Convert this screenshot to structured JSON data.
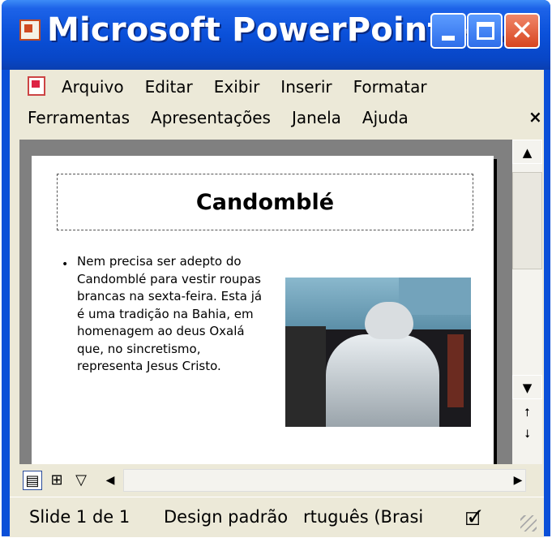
{
  "window": {
    "title": "Microsoft PowerPoint -..."
  },
  "titlebar_buttons": {
    "minimize": "_",
    "maximize": "□",
    "close": "✕"
  },
  "menu": {
    "row1": [
      "Arquivo",
      "Editar",
      "Exibir",
      "Inserir",
      "Formatar"
    ],
    "row2": [
      "Ferramentas",
      "Apresentações",
      "Janela",
      "Ajuda"
    ],
    "close_glyph": "×"
  },
  "slide": {
    "title": "Candomblé",
    "bullet_glyph": "•",
    "body": "Nem precisa ser adepto do Candomblé para vestir roupas brancas na sexta-feira. Esta já é uma tradição na Bahia, em homenagem ao deus Oxalá que, no sincretismo, representa Jesus Cristo."
  },
  "scroll": {
    "up": "▲",
    "down": "▼",
    "prev_slide": "⭡",
    "next_slide": "⭣",
    "left": "◀",
    "right": "▶"
  },
  "views": {
    "normal": "▤",
    "sorter": "⊞",
    "show": "▽"
  },
  "status": {
    "slide": "Slide 1 de 1",
    "design": "Design padrão",
    "language": "rtuguês (Brasi",
    "spell_icon": "🗹"
  },
  "colors": {
    "titlebar": "#0a50d9",
    "close_button": "#d7451f",
    "chrome": "#ece9d8",
    "canvas": "#808080"
  }
}
